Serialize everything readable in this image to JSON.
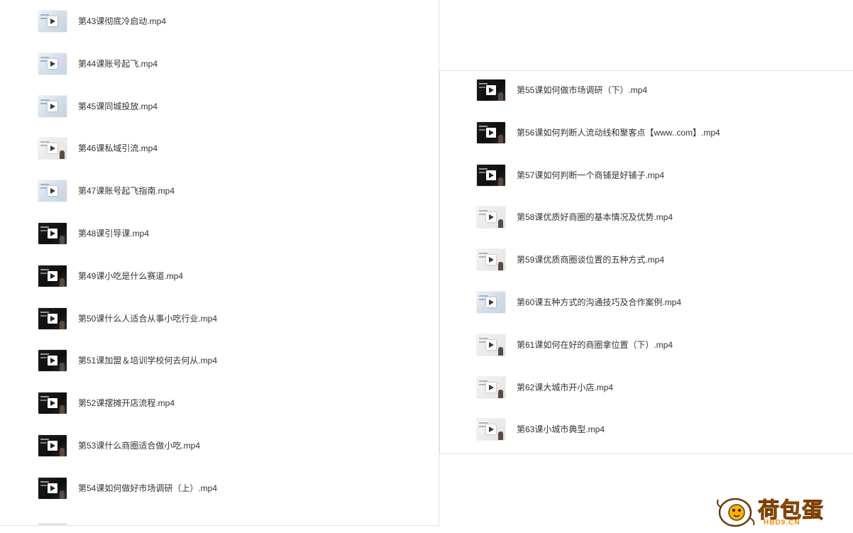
{
  "left_panel": {
    "items": [
      {
        "label": "第43课彻底冷启动.mp4",
        "thumb": "light"
      },
      {
        "label": "第44课账号起飞.mp4",
        "thumb": "light"
      },
      {
        "label": "第45课同城投放.mp4",
        "thumb": "light"
      },
      {
        "label": "第46课私域引流.mp4",
        "thumb": "grey"
      },
      {
        "label": "第47课账号起飞指南.mp4",
        "thumb": "light"
      },
      {
        "label": "第48课引导课.mp4",
        "thumb": "dark"
      },
      {
        "label": "第49课小吃是什么赛道.mp4",
        "thumb": "dark"
      },
      {
        "label": "第50课什么人适合从事小吃行业.mp4",
        "thumb": "dark"
      },
      {
        "label": "第51课加盟＆培训学校何去何从.mp4",
        "thumb": "dark"
      },
      {
        "label": "第52课摆摊开店流程.mp4",
        "thumb": "dark"
      },
      {
        "label": "第53课什么商圈适合做小吃.mp4",
        "thumb": "dark"
      },
      {
        "label": "第54课如何做好市场调研（上）.mp4",
        "thumb": "dark"
      }
    ]
  },
  "right_panel": {
    "items": [
      {
        "label": "第55课如何做市场调研（下）.mp4",
        "thumb": "dark"
      },
      {
        "label": "第56课如何判断人流动线和聚客点【www..com】.mp4",
        "thumb": "dark"
      },
      {
        "label": "第57课如何判断一个商铺是好铺子.mp4",
        "thumb": "dark"
      },
      {
        "label": "第58课优质好商圈的基本情况及优势.mp4",
        "thumb": "grey"
      },
      {
        "label": "第59课优质商圈谈位置的五种方式.mp4",
        "thumb": "grey"
      },
      {
        "label": "第60课五种方式的沟通技巧及合作案例.mp4",
        "thumb": "light"
      },
      {
        "label": "第61课如何在好的商圈拿位置（下）.mp4",
        "thumb": "grey"
      },
      {
        "label": "第62课大城市开小店.mp4",
        "thumb": "grey"
      },
      {
        "label": "第63课小城市典型.mp4",
        "thumb": "grey"
      }
    ]
  },
  "watermark": {
    "logo_text": "荷包蛋",
    "domain": "HBD9.CN",
    "colors": {
      "fill": "#f5a623",
      "outline": "#7a3d00"
    }
  },
  "icons": {
    "play": "play-icon",
    "mascot": "egg-mascot-icon"
  }
}
